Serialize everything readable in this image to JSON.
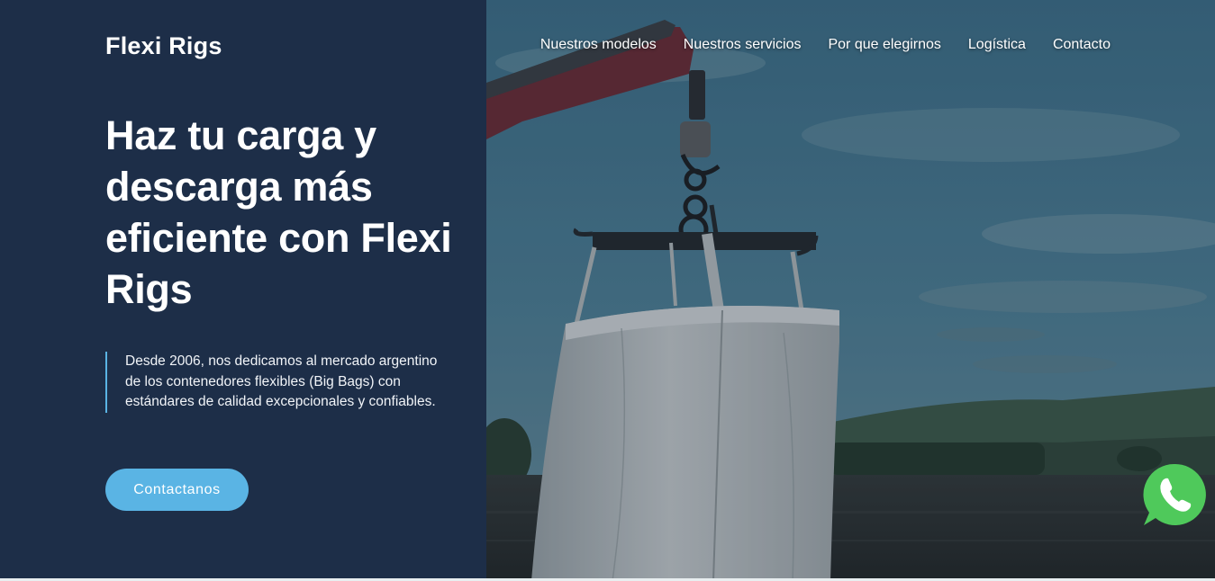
{
  "header": {
    "logo": "Flexi Rigs",
    "nav": [
      {
        "label": "Nuestros modelos"
      },
      {
        "label": "Nuestros servicios"
      },
      {
        "label": "Por que elegirnos"
      },
      {
        "label": "Logística"
      },
      {
        "label": "Contacto"
      }
    ]
  },
  "hero": {
    "headline": "Haz tu carga y descarga más eficiente con Flexi Rigs",
    "intro": "Desde 2006, nos dedicamos al mercado argentino de los contenedores flexibles (Big Bags) con estándares de calidad excepcionales y confiables.",
    "cta_label": "Contactanos"
  },
  "floating": {
    "whatsapp_icon": "whatsapp-icon"
  },
  "colors": {
    "panel_bg": "#1d2e48",
    "accent": "#5ab4e4",
    "whatsapp_green": "#4fc95b"
  }
}
